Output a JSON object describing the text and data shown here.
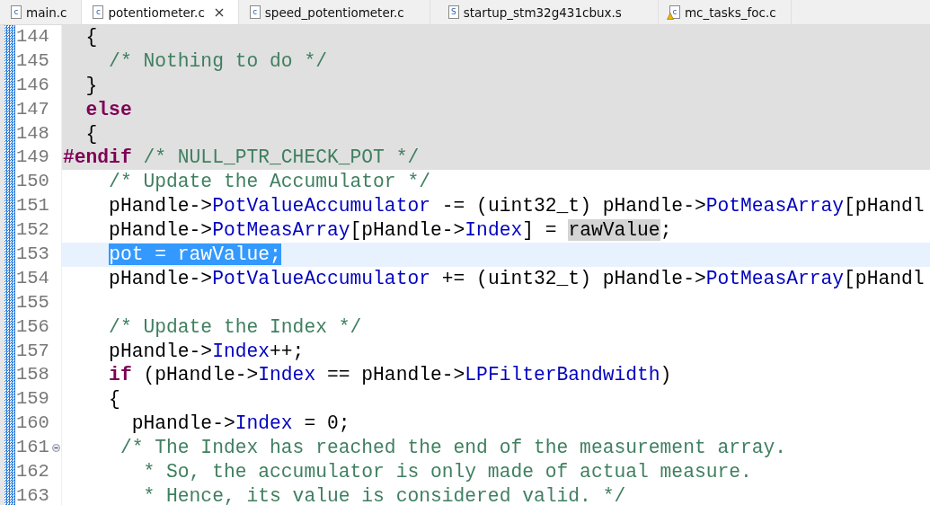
{
  "tabs": [
    {
      "label": "main.c",
      "icon": "c",
      "warning": false,
      "selected": false
    },
    {
      "label": "potentiometer.c",
      "icon": "c",
      "warning": false,
      "selected": true
    },
    {
      "label": "speed_potentiometer.c",
      "icon": "c",
      "warning": false,
      "selected": false
    },
    {
      "label": "startup_stm32g431cbux.s",
      "icon": "S",
      "warning": false,
      "selected": false
    },
    {
      "label": "mc_tasks_foc.c",
      "icon": "c",
      "warning": true,
      "selected": false
    }
  ],
  "lines": [
    {
      "number": "144",
      "inactive": true,
      "current": false,
      "fold": false,
      "tokens": [
        {
          "kind": "text",
          "text": "  {"
        }
      ]
    },
    {
      "number": "145",
      "inactive": true,
      "current": false,
      "fold": false,
      "tokens": [
        {
          "kind": "comment",
          "text": "    /* Nothing to do */"
        }
      ]
    },
    {
      "number": "146",
      "inactive": true,
      "current": false,
      "fold": false,
      "tokens": [
        {
          "kind": "text",
          "text": "  }"
        }
      ]
    },
    {
      "number": "147",
      "inactive": true,
      "current": false,
      "fold": false,
      "tokens": [
        {
          "kind": "keyword",
          "text": "  else"
        }
      ]
    },
    {
      "number": "148",
      "inactive": true,
      "current": false,
      "fold": false,
      "tokens": [
        {
          "kind": "text",
          "text": "  {"
        }
      ]
    },
    {
      "number": "149",
      "inactive": true,
      "current": false,
      "fold": false,
      "tokens": [
        {
          "kind": "preproc",
          "text": "#endif"
        },
        {
          "kind": "comment",
          "text": " /* NULL_PTR_CHECK_POT */"
        }
      ]
    },
    {
      "number": "150",
      "inactive": false,
      "current": false,
      "fold": false,
      "tokens": [
        {
          "kind": "comment",
          "text": "    /* Update the Accumulator */"
        }
      ]
    },
    {
      "number": "151",
      "inactive": false,
      "current": false,
      "fold": false,
      "tokens": [
        {
          "kind": "text",
          "text": "    pHandle->"
        },
        {
          "kind": "field",
          "text": "PotValueAccumulator"
        },
        {
          "kind": "text",
          "text": " -= (uint32_t) pHandle->"
        },
        {
          "kind": "field",
          "text": "PotMeasArray"
        },
        {
          "kind": "text",
          "text": "[pHandl"
        }
      ]
    },
    {
      "number": "152",
      "inactive": false,
      "current": false,
      "fold": false,
      "tokens": [
        {
          "kind": "text",
          "text": "    pHandle->"
        },
        {
          "kind": "field",
          "text": "PotMeasArray"
        },
        {
          "kind": "text",
          "text": "[pHandle->"
        },
        {
          "kind": "field",
          "text": "Index"
        },
        {
          "kind": "text",
          "text": "] = "
        },
        {
          "kind": "occurrence",
          "text": "rawValue"
        },
        {
          "kind": "text",
          "text": ";"
        }
      ]
    },
    {
      "number": "153",
      "inactive": false,
      "current": true,
      "fold": false,
      "tokens": [
        {
          "kind": "selection",
          "text": "    pot = rawValue;"
        }
      ]
    },
    {
      "number": "154",
      "inactive": false,
      "current": false,
      "fold": false,
      "tokens": [
        {
          "kind": "text",
          "text": "    pHandle->"
        },
        {
          "kind": "field",
          "text": "PotValueAccumulator"
        },
        {
          "kind": "text",
          "text": " += (uint32_t) pHandle->"
        },
        {
          "kind": "field",
          "text": "PotMeasArray"
        },
        {
          "kind": "text",
          "text": "[pHandl"
        }
      ]
    },
    {
      "number": "155",
      "inactive": false,
      "current": false,
      "fold": false
    },
    {
      "number": "156",
      "inactive": false,
      "current": false,
      "fold": false,
      "tokens": [
        {
          "kind": "comment",
          "text": "    /* Update the Index */"
        }
      ]
    },
    {
      "number": "157",
      "inactive": false,
      "current": false,
      "fold": false,
      "tokens": [
        {
          "kind": "text",
          "text": "    pHandle->"
        },
        {
          "kind": "field",
          "text": "Index"
        },
        {
          "kind": "text",
          "text": "++;"
        }
      ]
    },
    {
      "number": "158",
      "inactive": false,
      "current": false,
      "fold": false,
      "tokens": [
        {
          "kind": "keyword",
          "text": "    if"
        },
        {
          "kind": "text",
          "text": " (pHandle->"
        },
        {
          "kind": "field",
          "text": "Index"
        },
        {
          "kind": "text",
          "text": " == pHandle->"
        },
        {
          "kind": "field",
          "text": "LPFilterBandwidth"
        },
        {
          "kind": "text",
          "text": ")"
        }
      ]
    },
    {
      "number": "159",
      "inactive": false,
      "current": false,
      "fold": false,
      "tokens": [
        {
          "kind": "text",
          "text": "    {"
        }
      ]
    },
    {
      "number": "160",
      "inactive": false,
      "current": false,
      "fold": false,
      "tokens": [
        {
          "kind": "text",
          "text": "      pHandle->"
        },
        {
          "kind": "field",
          "text": "Index"
        },
        {
          "kind": "text",
          "text": " = 0;"
        }
      ]
    },
    {
      "number": "161",
      "inactive": false,
      "current": false,
      "fold": true,
      "tokens": [
        {
          "kind": "comment",
          "text": "     /* The Index has reached the end of the measurement array."
        }
      ]
    },
    {
      "number": "162",
      "inactive": false,
      "current": false,
      "fold": false,
      "tokens": [
        {
          "kind": "comment",
          "text": "       * So, the accumulator is only made of actual measure."
        }
      ]
    },
    {
      "number": "163",
      "inactive": false,
      "current": false,
      "fold": false,
      "tokens": [
        {
          "kind": "comment",
          "text": "       * Hence, its value is considered valid. */"
        }
      ]
    }
  ]
}
